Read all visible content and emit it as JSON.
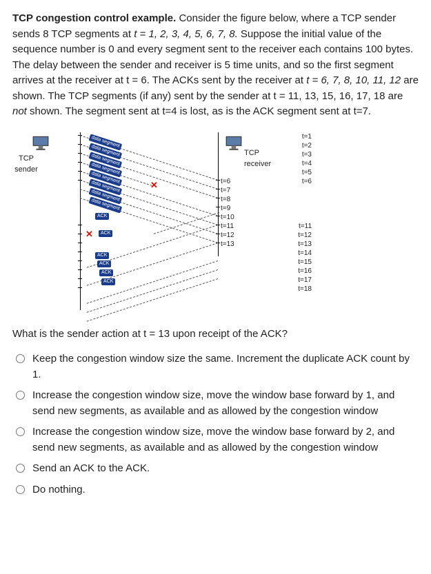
{
  "problem": {
    "title_bold": "TCP congestion control example.",
    "body1": "Consider the figure below, where a TCP sender sends 8 TCP segments at ",
    "times_eq": "t = 1, 2, 3, 4, 5, 6, 7, 8.",
    "body2": " Suppose the initial value of the sequence number is 0 and every segment sent to the receiver each contains 100 bytes. The delay between the sender and receiver is 5 time units, and so the first segment arrives at the receiver at t = 6.  The ACKs sent by the receiver at ",
    "ack_times": "t =  6, 7, 8, 10, 11, 12",
    "body3": " are shown.  The TCP segments (if any) sent by the sender at t = 11, 13, 15, 16, 17, 18 are ",
    "not_word": "not",
    "body4": " shown. The segment sent at t=4 is lost, as is the ACK segment sent at t=7."
  },
  "diagram": {
    "sender_label_line1": "TCP",
    "sender_label_line2": "sender",
    "receiver_label_line1": "TCP",
    "receiver_label_line2": "receiver",
    "seg_label": "data segment",
    "ack_label": "ACK",
    "sender_ticks": [
      "t=1",
      "t=2",
      "t=3",
      "t=4",
      "t=5",
      "t=6",
      "",
      "",
      "",
      "",
      "t=11",
      "t=12",
      "t=13",
      "t=14",
      "t=15",
      "t=16",
      "t=17",
      "t=18"
    ],
    "receiver_ticks": [
      "",
      "",
      "",
      "",
      "",
      "t=6",
      "t=7",
      "t=8",
      "t=9",
      "t=10",
      "t=11",
      "t=12",
      "t=13"
    ]
  },
  "question": "What is the sender action at t = 13 upon receipt of the ACK?",
  "options": [
    "Keep the congestion window size the same. Increment the duplicate ACK count by 1.",
    "Increase the congestion window size, move the window base forward by 1,  and send new segments, as available and as allowed by the congestion window",
    "Increase the congestion window size, move the window base forward by 2,  and send new segments, as available and as allowed by the congestion window",
    "Send an ACK to the ACK.",
    "Do nothing."
  ]
}
